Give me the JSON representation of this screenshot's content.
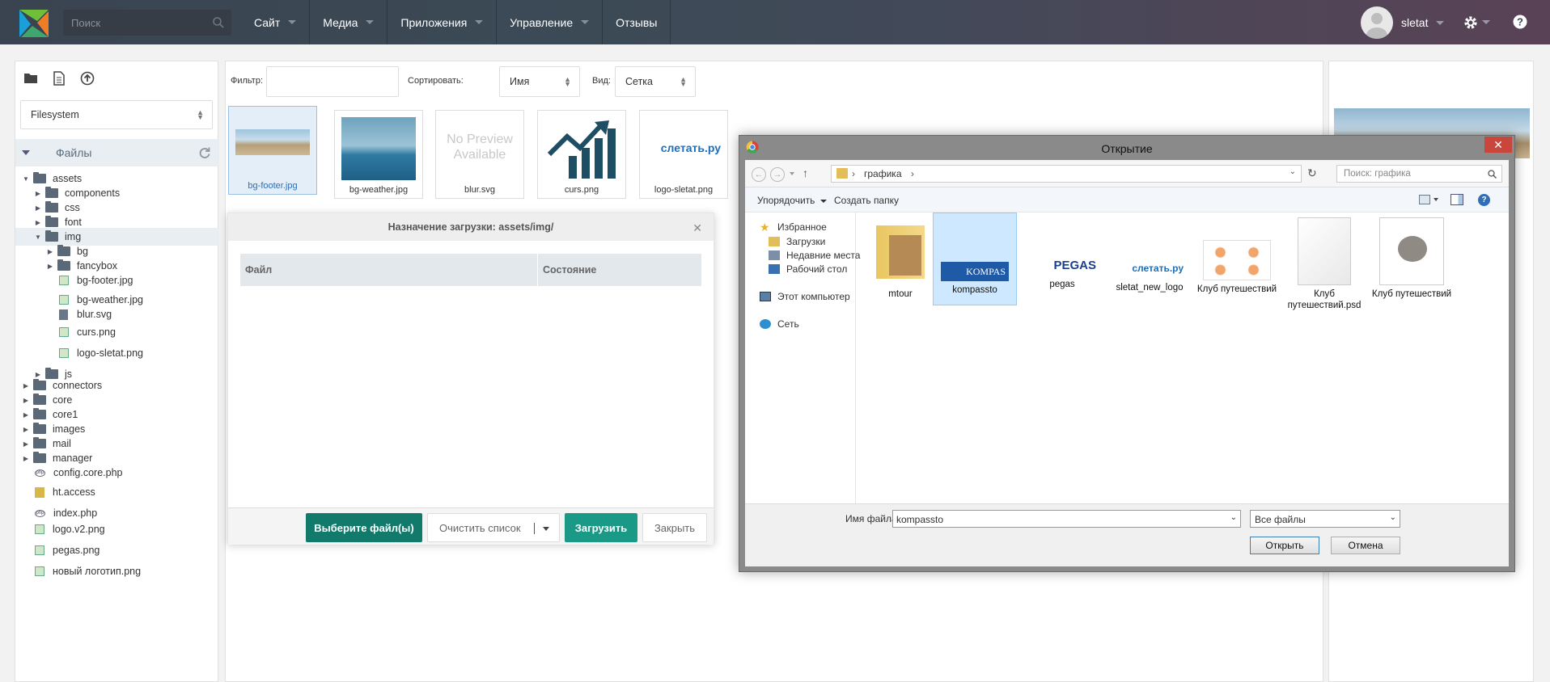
{
  "topbar": {
    "search_placeholder": "Поиск",
    "nav": [
      "Сайт",
      "Медиа",
      "Приложения",
      "Управление",
      "Отзывы"
    ],
    "nav_has_caret": [
      true,
      true,
      true,
      true,
      false
    ],
    "username": "sletat"
  },
  "sidebar": {
    "source": "Filesystem",
    "files_title": "Файлы",
    "tree": [
      {
        "label": "assets",
        "kind": "folder",
        "depth": 0,
        "exp": "open"
      },
      {
        "label": "components",
        "kind": "folder",
        "depth": 1,
        "exp": "closed"
      },
      {
        "label": "css",
        "kind": "folder",
        "depth": 1,
        "exp": "closed"
      },
      {
        "label": "font",
        "kind": "folder",
        "depth": 1,
        "exp": "closed"
      },
      {
        "label": "img",
        "kind": "folder",
        "depth": 1,
        "exp": "open",
        "selected": true
      },
      {
        "label": "bg",
        "kind": "folder",
        "depth": 2,
        "exp": "closed"
      },
      {
        "label": "fancybox",
        "kind": "folder",
        "depth": 2,
        "exp": "closed"
      },
      {
        "label": "bg-footer.jpg",
        "kind": "image",
        "depth": 2
      },
      {
        "label": "bg-weather.jpg",
        "kind": "image",
        "depth": 2
      },
      {
        "label": "blur.svg",
        "kind": "doc",
        "depth": 2
      },
      {
        "label": "curs.png",
        "kind": "image",
        "depth": 2
      },
      {
        "label": "logo-sletat.png",
        "kind": "image",
        "depth": 2
      },
      {
        "label": "js",
        "kind": "folder",
        "depth": 1,
        "exp": "closed"
      },
      {
        "label": "connectors",
        "kind": "folder",
        "depth": 0,
        "exp": "closed"
      },
      {
        "label": "core",
        "kind": "folder",
        "depth": 0,
        "exp": "closed"
      },
      {
        "label": "core1",
        "kind": "folder",
        "depth": 0,
        "exp": "closed"
      },
      {
        "label": "images",
        "kind": "folder",
        "depth": 0,
        "exp": "closed"
      },
      {
        "label": "mail",
        "kind": "folder",
        "depth": 0,
        "exp": "closed"
      },
      {
        "label": "manager",
        "kind": "folder",
        "depth": 0,
        "exp": "closed"
      },
      {
        "label": "config.core.php",
        "kind": "php",
        "depth": 0
      },
      {
        "label": "ht.access",
        "kind": "hta",
        "depth": 0
      },
      {
        "label": "index.php",
        "kind": "php",
        "depth": 0
      },
      {
        "label": "logo.v2.png",
        "kind": "image",
        "depth": 0
      },
      {
        "label": "pegas.png",
        "kind": "image",
        "depth": 0
      },
      {
        "label": "новый логотип.png",
        "kind": "image",
        "depth": 0
      }
    ]
  },
  "browser": {
    "filter_label": "Фильтр:",
    "sort_label": "Сортировать:",
    "sort_value": "Имя",
    "view_label": "Вид:",
    "view_value": "Сетка",
    "thumbs": [
      "bg-footer.jpg",
      "bg-weather.jpg",
      "blur.svg",
      "curs.png",
      "logo-sletat.png"
    ],
    "no_preview": "No Preview Available",
    "sletat_logo_text": "слетать.ру"
  },
  "upload": {
    "title": "Назначение загрузки: assets/img/",
    "col_file": "Файл",
    "col_state": "Состояние",
    "choose": "Выберите файл(ы)",
    "clear": "Очистить список",
    "upload": "Загрузить",
    "close": "Закрыть"
  },
  "dialog": {
    "title": "Открытие",
    "path": "графика",
    "search_placeholder": "Поиск: графика",
    "organize": "Упорядочить",
    "new_folder": "Создать папку",
    "nav": {
      "favorites": "Избранное",
      "downloads": "Загрузки",
      "recent": "Недавние места",
      "desktop": "Рабочий стол",
      "computer": "Этот компьютер",
      "network": "Сеть"
    },
    "files": [
      "mtour",
      "kompassto",
      "pegas",
      "sletat_new_logo",
      "Клуб путешествий",
      "Клуб путешествий.psd",
      "Клуб путешествий"
    ],
    "filename_label": "Имя файла:",
    "filename": "kompassto",
    "filetype": "Все файлы",
    "open": "Открыть",
    "cancel": "Отмена",
    "kompas_text": "KOMPAS",
    "pegas_text": "PEGAS"
  }
}
